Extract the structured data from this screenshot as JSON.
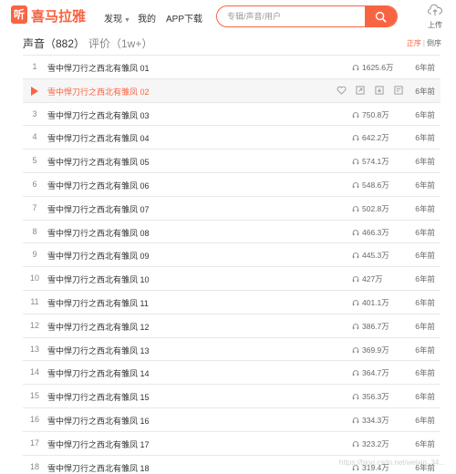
{
  "brand": {
    "logo_glyph": "听",
    "logo_text": "喜马拉雅",
    "accent": "#f86442"
  },
  "nav": [
    {
      "label": "发现",
      "has_caret": true
    },
    {
      "label": "我的",
      "has_caret": false
    },
    {
      "label": "APP下载",
      "has_caret": false
    }
  ],
  "search": {
    "placeholder": "专辑/声音/用户",
    "icon": "search-icon"
  },
  "upload": {
    "label": "上传",
    "icon": "upload-cloud-icon"
  },
  "tabs": {
    "sound": "声音（882）",
    "review": "评价（1w+）"
  },
  "sort": {
    "asc": "正序",
    "separator": "|",
    "desc": "倒序"
  },
  "tracks": [
    {
      "index": "1",
      "title": "雪中悍刀行之西北有雏凤 01",
      "plays": "1625.6万",
      "time": "6年前"
    },
    {
      "index": "2",
      "title": "雪中悍刀行之西北有雏凤 02",
      "plays": "",
      "time": "6年前",
      "playing": true
    },
    {
      "index": "3",
      "title": "雪中悍刀行之西北有雏凤 03",
      "plays": "750.8万",
      "time": "6年前"
    },
    {
      "index": "4",
      "title": "雪中悍刀行之西北有雏凤 04",
      "plays": "642.2万",
      "time": "6年前"
    },
    {
      "index": "5",
      "title": "雪中悍刀行之西北有雏凤 05",
      "plays": "574.1万",
      "time": "6年前"
    },
    {
      "index": "6",
      "title": "雪中悍刀行之西北有雏凤 06",
      "plays": "548.6万",
      "time": "6年前"
    },
    {
      "index": "7",
      "title": "雪中悍刀行之西北有雏凤 07",
      "plays": "502.8万",
      "time": "6年前"
    },
    {
      "index": "8",
      "title": "雪中悍刀行之西北有雏凤 08",
      "plays": "466.3万",
      "time": "6年前"
    },
    {
      "index": "9",
      "title": "雪中悍刀行之西北有雏凤 09",
      "plays": "445.3万",
      "time": "6年前"
    },
    {
      "index": "10",
      "title": "雪中悍刀行之西北有雏凤 10",
      "plays": "427万",
      "time": "6年前"
    },
    {
      "index": "11",
      "title": "雪中悍刀行之西北有雏凤 11",
      "plays": "401.1万",
      "time": "6年前"
    },
    {
      "index": "12",
      "title": "雪中悍刀行之西北有雏凤 12",
      "plays": "386.7万",
      "time": "6年前"
    },
    {
      "index": "13",
      "title": "雪中悍刀行之西北有雏凤 13",
      "plays": "369.9万",
      "time": "6年前"
    },
    {
      "index": "14",
      "title": "雪中悍刀行之西北有雏凤 14",
      "plays": "364.7万",
      "time": "6年前"
    },
    {
      "index": "15",
      "title": "雪中悍刀行之西北有雏凤 15",
      "plays": "356.3万",
      "time": "6年前"
    },
    {
      "index": "16",
      "title": "雪中悍刀行之西北有雏凤 16",
      "plays": "334.3万",
      "time": "6年前"
    },
    {
      "index": "17",
      "title": "雪中悍刀行之西北有雏凤 17",
      "plays": "323.2万",
      "time": "6年前"
    },
    {
      "index": "18",
      "title": "雪中悍刀行之西北有雏凤 18",
      "plays": "319.4万",
      "time": "6年前"
    }
  ],
  "row_actions": [
    "heart-icon",
    "share-icon",
    "download-icon",
    "add-to-playlist-icon"
  ],
  "watermark": "https://blog.csdn.net/weixin_34..."
}
